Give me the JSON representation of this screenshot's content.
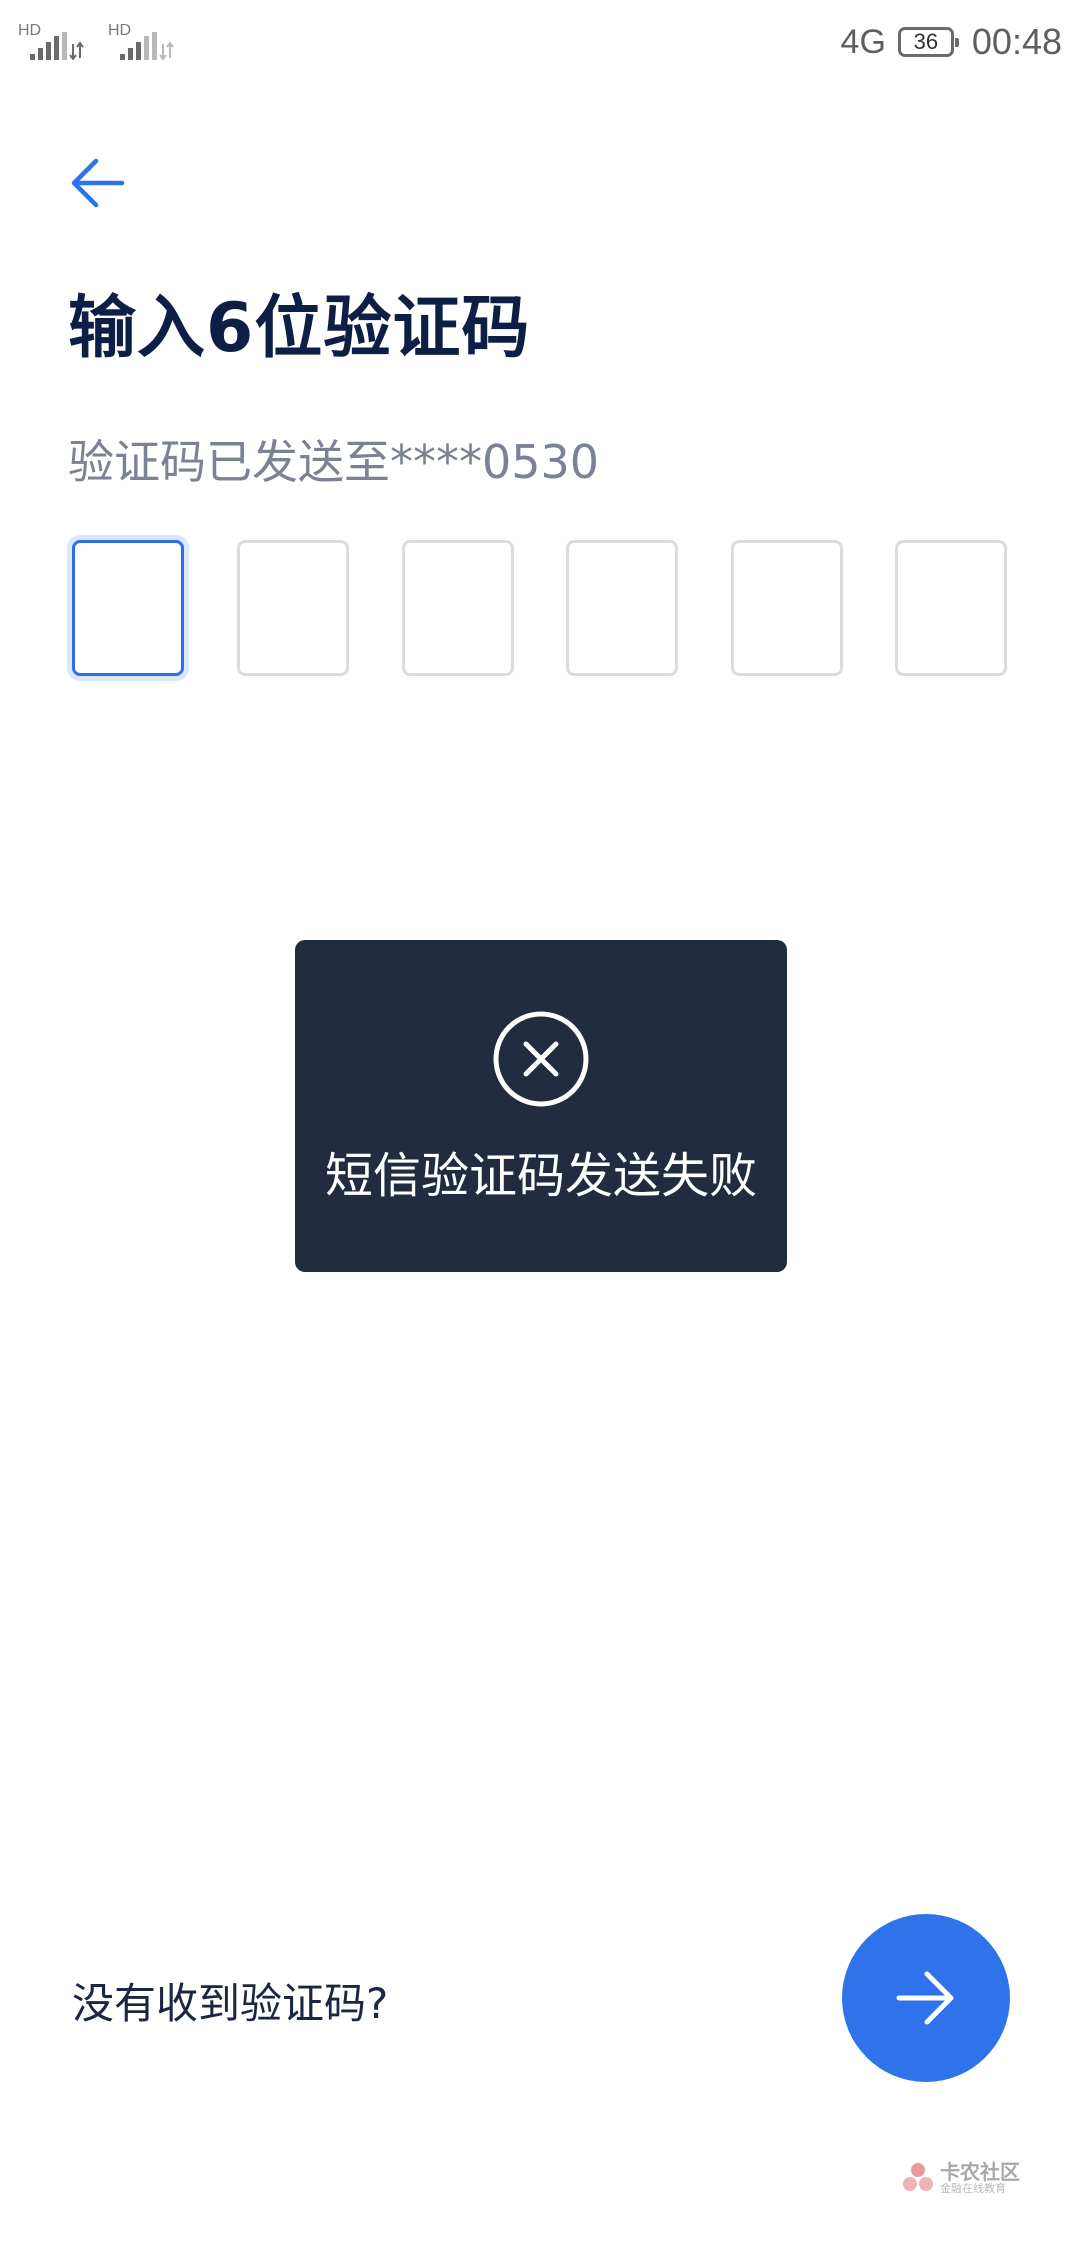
{
  "status_bar": {
    "sim1_label": "HD",
    "sim2_label": "HD",
    "network": "4G",
    "battery": "36",
    "time": "00:48"
  },
  "header": {
    "title": "输入6位验证码",
    "subtitle": "验证码已发送至****0530"
  },
  "code_input": {
    "length": 6,
    "values": [
      "",
      "",
      "",
      "",
      "",
      ""
    ],
    "active_index": 0
  },
  "toast": {
    "icon": "close-circle-icon",
    "message": "短信验证码发送失败"
  },
  "footer": {
    "resend_label": "没有收到验证码?",
    "next_icon": "arrow-right-icon"
  },
  "watermark": {
    "text": "卡农社区",
    "subtext": "金融在线教育"
  },
  "colors": {
    "accent": "#2f73ec",
    "title": "#0e1f46",
    "subtitle": "#7a8293",
    "toast_bg": "#212c41",
    "box_border": "#d9dce1"
  }
}
